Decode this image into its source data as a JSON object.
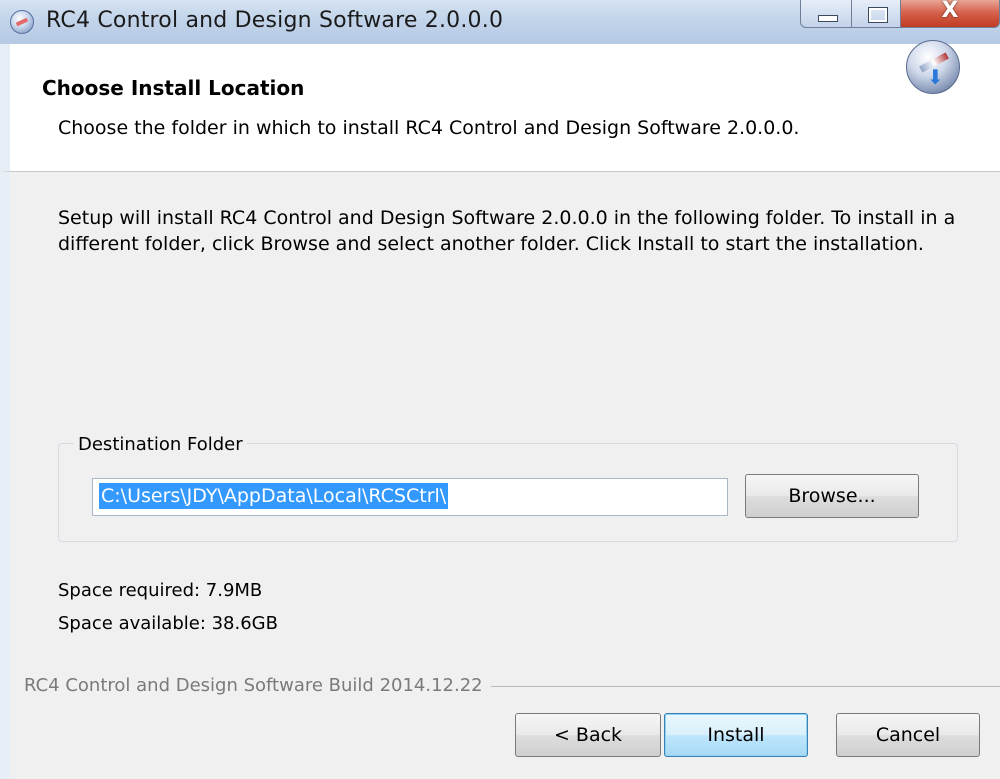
{
  "window": {
    "title": "RC4 Control and Design Software 2.0.0.0",
    "close_glyph": "X"
  },
  "header": {
    "title": "Choose Install Location",
    "subtitle": "Choose the folder in which to install RC4 Control and Design Software 2.0.0.0."
  },
  "body": {
    "intro": "Setup will install RC4 Control and Design Software 2.0.0.0 in the following folder. To install in a different folder, click Browse and select another folder. Click Install to start the installation.",
    "destination": {
      "legend": "Destination Folder",
      "path": "C:\\Users\\JDY\\AppData\\Local\\RCSCtrl\\",
      "browse_label": "Browse..."
    },
    "space_required": "Space required: 7.9MB",
    "space_available": "Space available: 38.6GB",
    "build_label": "RC4 Control and Design Software Build 2014.12.22"
  },
  "buttons": {
    "back": "< Back",
    "install": "Install",
    "cancel": "Cancel"
  },
  "icons": [
    "app-icon",
    "minimize-icon",
    "maximize-icon",
    "close-icon",
    "installer-icon"
  ],
  "colors": {
    "selection": "#3399ff",
    "dialog_bg": "#f0f0f0",
    "default_button_border": "#3c7fb1"
  }
}
